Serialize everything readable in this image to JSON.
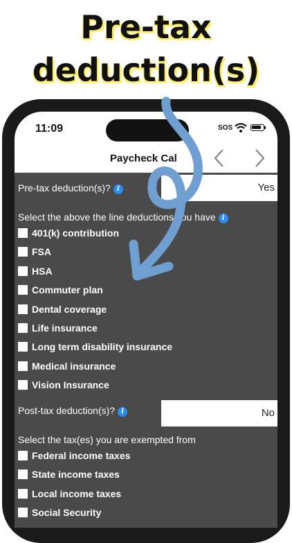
{
  "headline": {
    "line1": "Pre-tax",
    "line2": "deduction(s)"
  },
  "status_bar": {
    "time": "11:09",
    "sos": "SOS"
  },
  "nav": {
    "title": "Paycheck Cal",
    "back_icon": "chevron-left-icon",
    "forward_icon": "chevron-right-icon"
  },
  "pretax": {
    "label": "Pre-tax deduction(s)?",
    "value": "Yes",
    "info_icon": "info-icon"
  },
  "above_line": {
    "label": "Select the above the line deductions you have",
    "items": [
      "401(k) contribution",
      "FSA",
      "HSA",
      "Commuter plan",
      "Dental coverage",
      "Life insurance",
      "Long term disability insurance",
      "Medical insurance",
      "Vision Insurance"
    ]
  },
  "posttax": {
    "label": "Post-tax deduction(s)?",
    "value": "No"
  },
  "exempt": {
    "label": "Select the tax(es) you are exempted from",
    "items": [
      "Federal income taxes",
      "State income taxes",
      "Local income taxes",
      "Social Security"
    ]
  },
  "colors": {
    "accent_arrow": "#6f9fd0",
    "info_blue": "#2b8cf2",
    "panel_bg": "#4a4a4a",
    "headline_highlight": "#fff06a"
  }
}
